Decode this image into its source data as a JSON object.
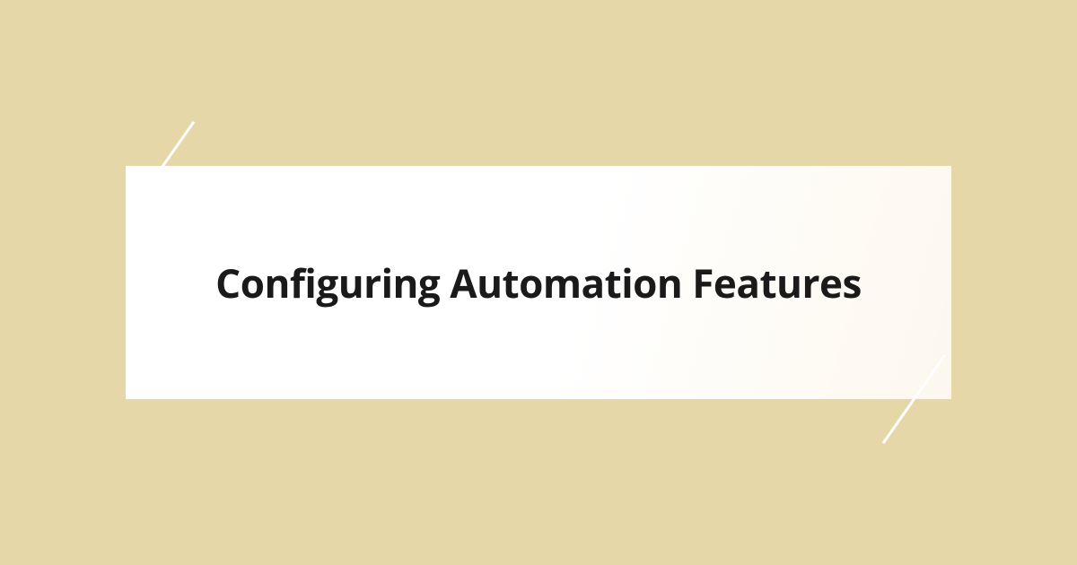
{
  "title": "Configuring Automation Features"
}
